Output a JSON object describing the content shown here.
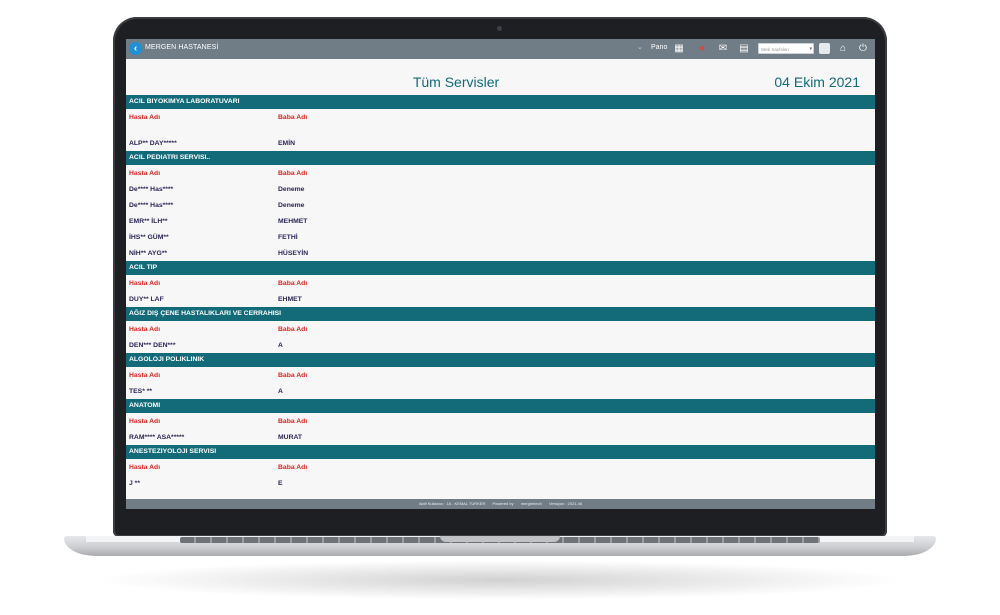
{
  "topbar": {
    "hospital": "MERGEN HASTANESİ",
    "pano": "Pano",
    "lang_placeholder": "Web Sayfaları"
  },
  "page": {
    "title": "Tüm Servisler",
    "date": "04 Ekim 2021"
  },
  "columns": {
    "patient": "Hasta Adı",
    "father": "Baba Adı"
  },
  "sections": [
    {
      "name": "ACIL BIYOKIMYA LABORATUVARI",
      "rows": [
        {
          "patient": "ALP** DAY*****",
          "father": "EMİN"
        }
      ]
    },
    {
      "name": "ACIL PEDIATRI SERVISI..",
      "rows": [
        {
          "patient": "De**** Has****",
          "father": "Deneme"
        },
        {
          "patient": "De**** Has****",
          "father": "Deneme"
        },
        {
          "patient": "EMR** İLH**",
          "father": "MEHMET"
        },
        {
          "patient": "İHS** GÜM**",
          "father": "FETHİ"
        },
        {
          "patient": "NİH** AYG**",
          "father": "HÜSEYİN"
        }
      ]
    },
    {
      "name": "ACIL TIP",
      "rows": [
        {
          "patient": "DUY** LAF",
          "father": "EHMET"
        }
      ]
    },
    {
      "name": "AĞIZ DIŞ ÇENE HASTALIKLARI VE CERRAHISI",
      "rows": [
        {
          "patient": "DEN*** DEN***",
          "father": "A"
        }
      ]
    },
    {
      "name": "ALGOLOJI POLIKLINIK",
      "rows": [
        {
          "patient": "TES* **",
          "father": "A"
        }
      ]
    },
    {
      "name": "ANATOMI",
      "rows": [
        {
          "patient": "RAM**** ASA*****",
          "father": "MURAT"
        }
      ]
    },
    {
      "name": "ANESTEZIYOLOJI SERVISI",
      "rows": [
        {
          "patient": "J **",
          "father": "E"
        }
      ]
    }
  ],
  "footer": {
    "user": "Aktif Kullanıcı : 18 - KEMAL TÜRKER",
    "powered": "Powered by",
    "brand": "mergentech",
    "version": "Versiyon : 2021.46"
  },
  "colors": {
    "accent": "#136a78",
    "topbar": "#707c86",
    "header_text": "#e0241e",
    "data_text": "#2a2656"
  }
}
